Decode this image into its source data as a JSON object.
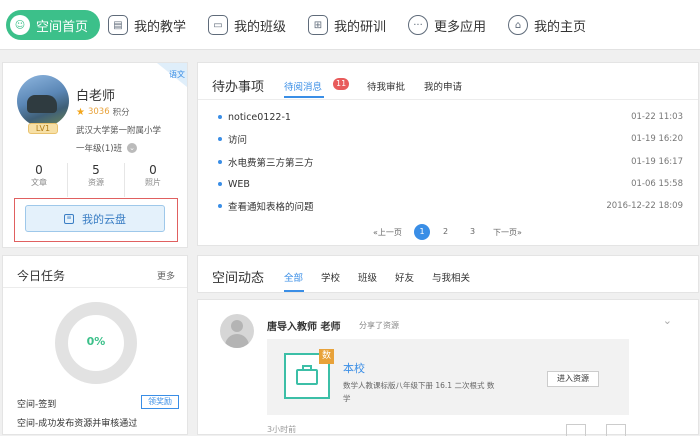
{
  "nav": [
    {
      "label": "空间首页",
      "icon": "smile-icon"
    },
    {
      "label": "我的教学",
      "icon": "book-icon"
    },
    {
      "label": "我的班级",
      "icon": "monitor-icon"
    },
    {
      "label": "我的研训",
      "icon": "grid-icon"
    },
    {
      "label": "更多应用",
      "icon": "more-icon"
    },
    {
      "label": "我的主页",
      "icon": "home-icon"
    }
  ],
  "profile": {
    "corner_tag": "语文",
    "name": "白老师",
    "points_value": "3036",
    "points_label": "积分",
    "level": "LV1",
    "school": "武汉大学第一附属小学",
    "class_name": "一年级(1)班",
    "stats": [
      {
        "value": "0",
        "label": "文章"
      },
      {
        "value": "5",
        "label": "资源"
      },
      {
        "value": "0",
        "label": "照片"
      }
    ],
    "cloud_button": "我的云盘"
  },
  "todo": {
    "title": "待办事项",
    "tabs": [
      "待阅消息",
      "待我审批",
      "我的申请"
    ],
    "badge": "11",
    "items": [
      {
        "title": "notice0122-1",
        "date": "01-22 11:03"
      },
      {
        "title": "访问",
        "date": "01-19 16:20"
      },
      {
        "title": "水电费第三方第三方",
        "date": "01-19 16:17"
      },
      {
        "title": "WEB",
        "date": "01-06 15:58"
      },
      {
        "title": "查看通知表格的问题",
        "date": "2016-12-22 18:09"
      }
    ],
    "pagination": {
      "prev": "«上一页",
      "pages": [
        "1",
        "2",
        "3"
      ],
      "next": "下一页»"
    }
  },
  "tasks": {
    "title": "今日任务",
    "more": "更多",
    "progress": "0%",
    "items": [
      {
        "label": "空间-签到",
        "action": "领奖励"
      },
      {
        "label": "空间-成功发布资源并审核通过"
      }
    ]
  },
  "feed": {
    "title": "空间动态",
    "tabs": [
      "全部",
      "学校",
      "班级",
      "好友",
      "与我相关"
    ],
    "post": {
      "author": "唐导入教师 老师",
      "action": "分享了资源",
      "resource_badge": "数",
      "resource_title": "本校",
      "resource_desc": "数学人教课标版八年级下册 16.1 二次根式 数学",
      "enter_button": "进入资源",
      "time": "3小时前"
    }
  },
  "colors": {
    "accent_green": "#3cc08a",
    "accent_blue": "#3a8ee6",
    "badge_red": "#e85b5b",
    "highlight_red": "#e06060"
  }
}
